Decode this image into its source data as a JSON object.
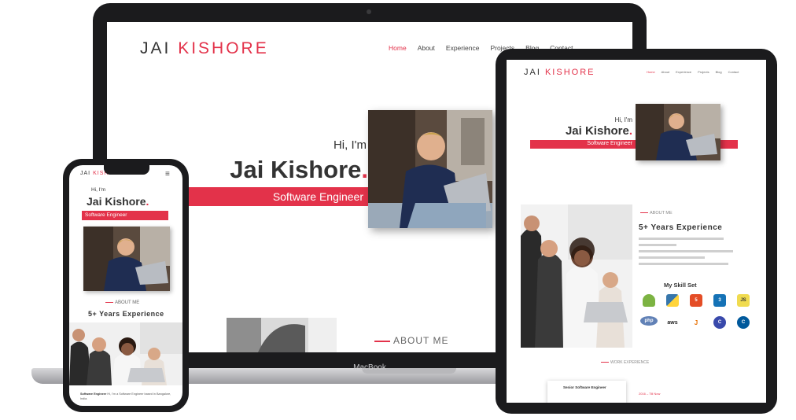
{
  "site": {
    "logo_first": "JAI",
    "logo_last": "KISHORE",
    "nav": [
      "Home",
      "About",
      "Experience",
      "Projects",
      "Blog",
      "Contact"
    ],
    "greeting": "Hi, I'm",
    "name": "Jai Kishore",
    "name_dot": ".",
    "role": "Software Engineer",
    "about_label": "ABOUT ME",
    "experience_title": "5+ Years Experience",
    "skills_title": "My Skill Set",
    "skills": [
      "android-icon",
      "python-icon",
      "html5-icon",
      "css3-icon",
      "js-icon",
      "php-icon",
      "aws-icon",
      "java-icon",
      "c-icon",
      "cpp-icon"
    ],
    "skill_labels": [
      "",
      "",
      "5",
      "3",
      "JS",
      "php",
      "aws",
      "J",
      "C",
      "C"
    ],
    "work_label": "WORK EXPERIENCE",
    "card_title": "Senior Software Engineer",
    "card_date": "2016 – Till Now",
    "phone_text_bold": "Software Engineer",
    "phone_text_rest": "Hi, I'm a Software Engineer based in Bangalore, India.",
    "menu_icon": "≡"
  },
  "device": {
    "laptop_brand": "MacBook"
  },
  "colors": {
    "accent": "#e3324a",
    "device_frame": "#1b1b1d"
  }
}
